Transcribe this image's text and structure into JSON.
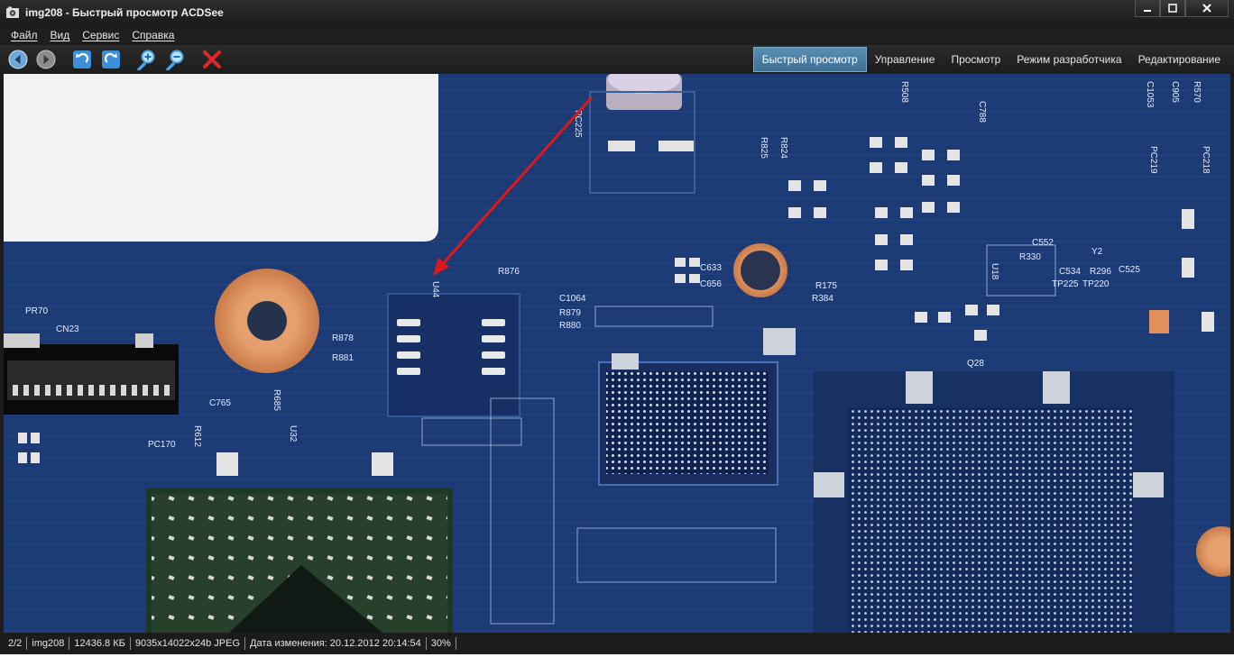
{
  "window": {
    "title": "img208 - Быстрый просмотр ACDSee"
  },
  "menu": {
    "items": [
      "Файл",
      "Вид",
      "Сервис",
      "Справка"
    ]
  },
  "toolbar": {
    "buttons": [
      {
        "icon": "previous-icon"
      },
      {
        "icon": "next-icon"
      },
      {
        "icon": "rotate-left-icon"
      },
      {
        "icon": "rotate-right-icon"
      },
      {
        "icon": "zoom-in-icon"
      },
      {
        "icon": "zoom-out-icon"
      },
      {
        "icon": "delete-icon"
      }
    ],
    "modes": [
      {
        "label": "Быстрый просмотр",
        "active": true
      },
      {
        "label": "Управление",
        "active": false
      },
      {
        "label": "Просмотр",
        "active": false
      },
      {
        "label": "Режим разработчика",
        "active": false
      },
      {
        "label": "Редактирование",
        "active": false
      }
    ]
  },
  "image": {
    "labels": [
      "U44",
      "R878",
      "R881",
      "C765",
      "CN23",
      "R876",
      "C1064",
      "R879",
      "R880",
      "C633",
      "C656",
      "Q28",
      "Y2",
      "C534",
      "R296",
      "C525",
      "TP225",
      "TP220",
      "R384",
      "R175",
      "PR70",
      "C552",
      "R330",
      "U18",
      "R685",
      "U32",
      "PC170",
      "R612",
      "C788",
      "R825",
      "R824",
      "PC225",
      "PC219",
      "PC218",
      "R508",
      "C905",
      "R570",
      "C1053"
    ]
  },
  "status": {
    "index": "2/2",
    "filename": "img208",
    "filesize": "12436.8 КБ",
    "dimensions": "9035x14022x24b JPEG",
    "modified": "Дата изменения: 20.12.2012 20:14:54",
    "zoom": "30%"
  },
  "colors": {
    "board": "#1c3a73",
    "accent_tab": "#4a7ea6",
    "arrow": "#e01818",
    "chrome": "#1d1d1d"
  }
}
